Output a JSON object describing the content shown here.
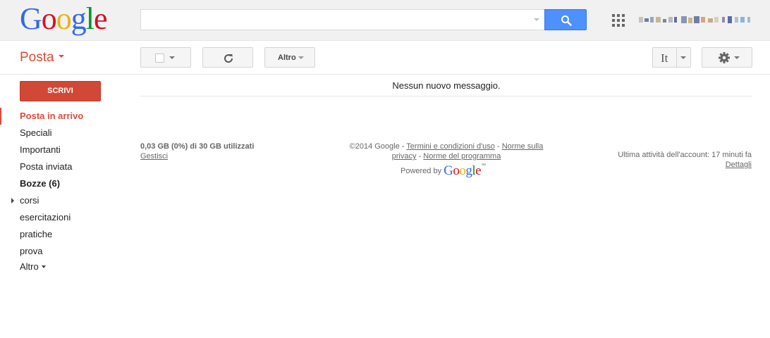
{
  "header": {
    "logo_letters": [
      {
        "ch": "G",
        "color": "#3369e8"
      },
      {
        "ch": "o",
        "color": "#d50f25"
      },
      {
        "ch": "o",
        "color": "#eeb211"
      },
      {
        "ch": "g",
        "color": "#3369e8"
      },
      {
        "ch": "l",
        "color": "#009925"
      },
      {
        "ch": "e",
        "color": "#d50f25"
      }
    ],
    "search_value": "",
    "search_icon": "search-icon",
    "apps_icon": "apps-grid-icon"
  },
  "toolbar": {
    "app_label": "Posta",
    "more_label": "Altro",
    "lang_label": "It"
  },
  "sidebar": {
    "compose_label": "SCRIVI",
    "items": [
      {
        "label": "Posta in arrivo"
      },
      {
        "label": "Speciali"
      },
      {
        "label": "Importanti"
      },
      {
        "label": "Posta inviata"
      },
      {
        "label": "Bozze (6)"
      },
      {
        "label": "corsi"
      },
      {
        "label": "esercitazioni"
      },
      {
        "label": "pratiche"
      },
      {
        "label": "prova"
      }
    ],
    "more_label": "Altro"
  },
  "main": {
    "empty_message": "Nessun nuovo messaggio."
  },
  "footer": {
    "storage_used": "0,03 GB (0%) di 30 GB utilizzati",
    "manage_link": "Gestisci",
    "copyright": "©2014 Google",
    "sep": " - ",
    "terms_link": "Termini e condizioni d'uso",
    "privacy_link_1": "Norme sulla",
    "privacy_link_2": "privacy",
    "program_link": "Norme del programma",
    "powered_by": "Powered by",
    "powered_logo": "Google",
    "tm": "™",
    "last_activity": "Ultima attività dell'account: 17 minuti fa",
    "details_link": "Dettagli"
  },
  "colors": {
    "accent_red": "#dd4b39",
    "compose_red": "#d14836",
    "search_blue": "#4d90fe"
  }
}
